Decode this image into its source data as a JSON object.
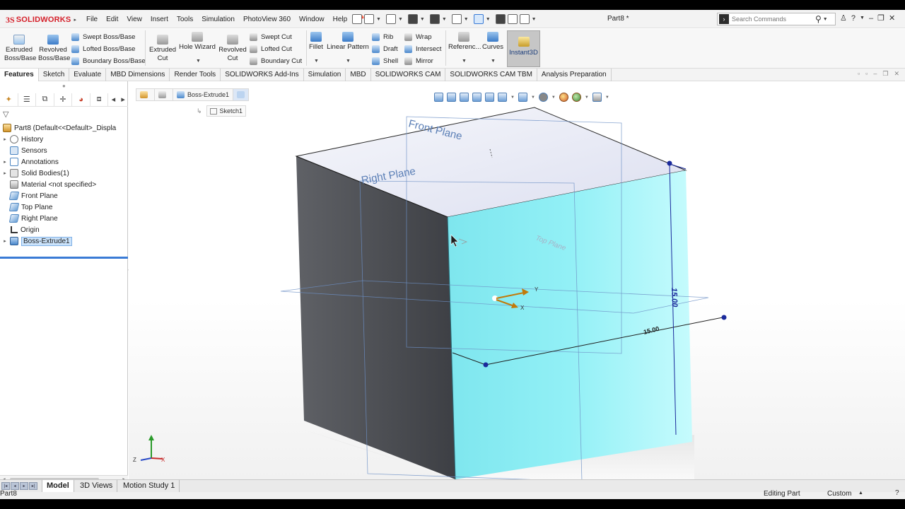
{
  "app": {
    "logo_ds": "3S",
    "logo_name": "SOLIDWORKS",
    "document_title": "Part8 *",
    "menu": [
      "File",
      "Edit",
      "View",
      "Insert",
      "Tools",
      "Simulation",
      "PhotoView 360",
      "Window",
      "Help"
    ],
    "search_placeholder": "Search Commands"
  },
  "command_manager": {
    "extruded_boss": "Extruded Boss/Base",
    "revolved_boss": "Revolved Boss/Base",
    "swept_boss": "Swept Boss/Base",
    "lofted_boss": "Lofted Boss/Base",
    "boundary_boss": "Boundary Boss/Base",
    "extruded_cut": "Extruded Cut",
    "hole_wizard": "Hole Wizard",
    "revolved_cut": "Revolved Cut",
    "swept_cut": "Swept Cut",
    "lofted_cut": "Lofted Cut",
    "boundary_cut": "Boundary Cut",
    "fillet": "Fillet",
    "linear_pattern": "Linear Pattern",
    "rib": "Rib",
    "draft": "Draft",
    "shell": "Shell",
    "wrap": "Wrap",
    "intersect": "Intersect",
    "mirror": "Mirror",
    "reference": "Referenc...",
    "curves": "Curves",
    "instant3d": "Instant3D"
  },
  "tabs": [
    "Features",
    "Sketch",
    "Evaluate",
    "MBD Dimensions",
    "Render Tools",
    "SOLIDWORKS Add-Ins",
    "Simulation",
    "MBD",
    "SOLIDWORKS CAM",
    "SOLIDWORKS CAM TBM",
    "Analysis Preparation"
  ],
  "active_tab": "Features",
  "feature_tree": {
    "root": "Part8  (Default<<Default>_Displa",
    "items": [
      {
        "label": "History",
        "icon": "history-icon"
      },
      {
        "label": "Sensors",
        "icon": "sensors-icon"
      },
      {
        "label": "Annotations",
        "icon": "annotations-icon"
      },
      {
        "label": "Solid Bodies(1)",
        "icon": "solid-bodies-icon"
      },
      {
        "label": "Material <not specified>",
        "icon": "material-icon"
      },
      {
        "label": "Front Plane",
        "icon": "plane-icon"
      },
      {
        "label": "Top Plane",
        "icon": "plane-icon"
      },
      {
        "label": "Right Plane",
        "icon": "plane-icon"
      },
      {
        "label": "Origin",
        "icon": "origin-icon"
      },
      {
        "label": "Boss-Extrude1",
        "icon": "boss-extrude-icon"
      }
    ]
  },
  "breadcrumb": {
    "feature": "Boss-Extrude1",
    "sketch": "Sketch1"
  },
  "viewport": {
    "front_plane": "Front Plane",
    "right_plane": "Right Plane",
    "top_plane": "Top Plane",
    "dim_height": "15.00",
    "dim_width": "15.00",
    "axis_x": "X",
    "axis_y": "Y",
    "triad_z": "Z",
    "triad_x": "X",
    "colors": {
      "selected_face": "#86eef4",
      "dimension": "#1a2a9c",
      "plane_label": "#5b7fb6"
    }
  },
  "bottom_tabs": [
    "Model",
    "3D Views",
    "Motion Study 1"
  ],
  "status": {
    "left": "Part8",
    "mode": "Editing Part",
    "units": "Custom"
  }
}
